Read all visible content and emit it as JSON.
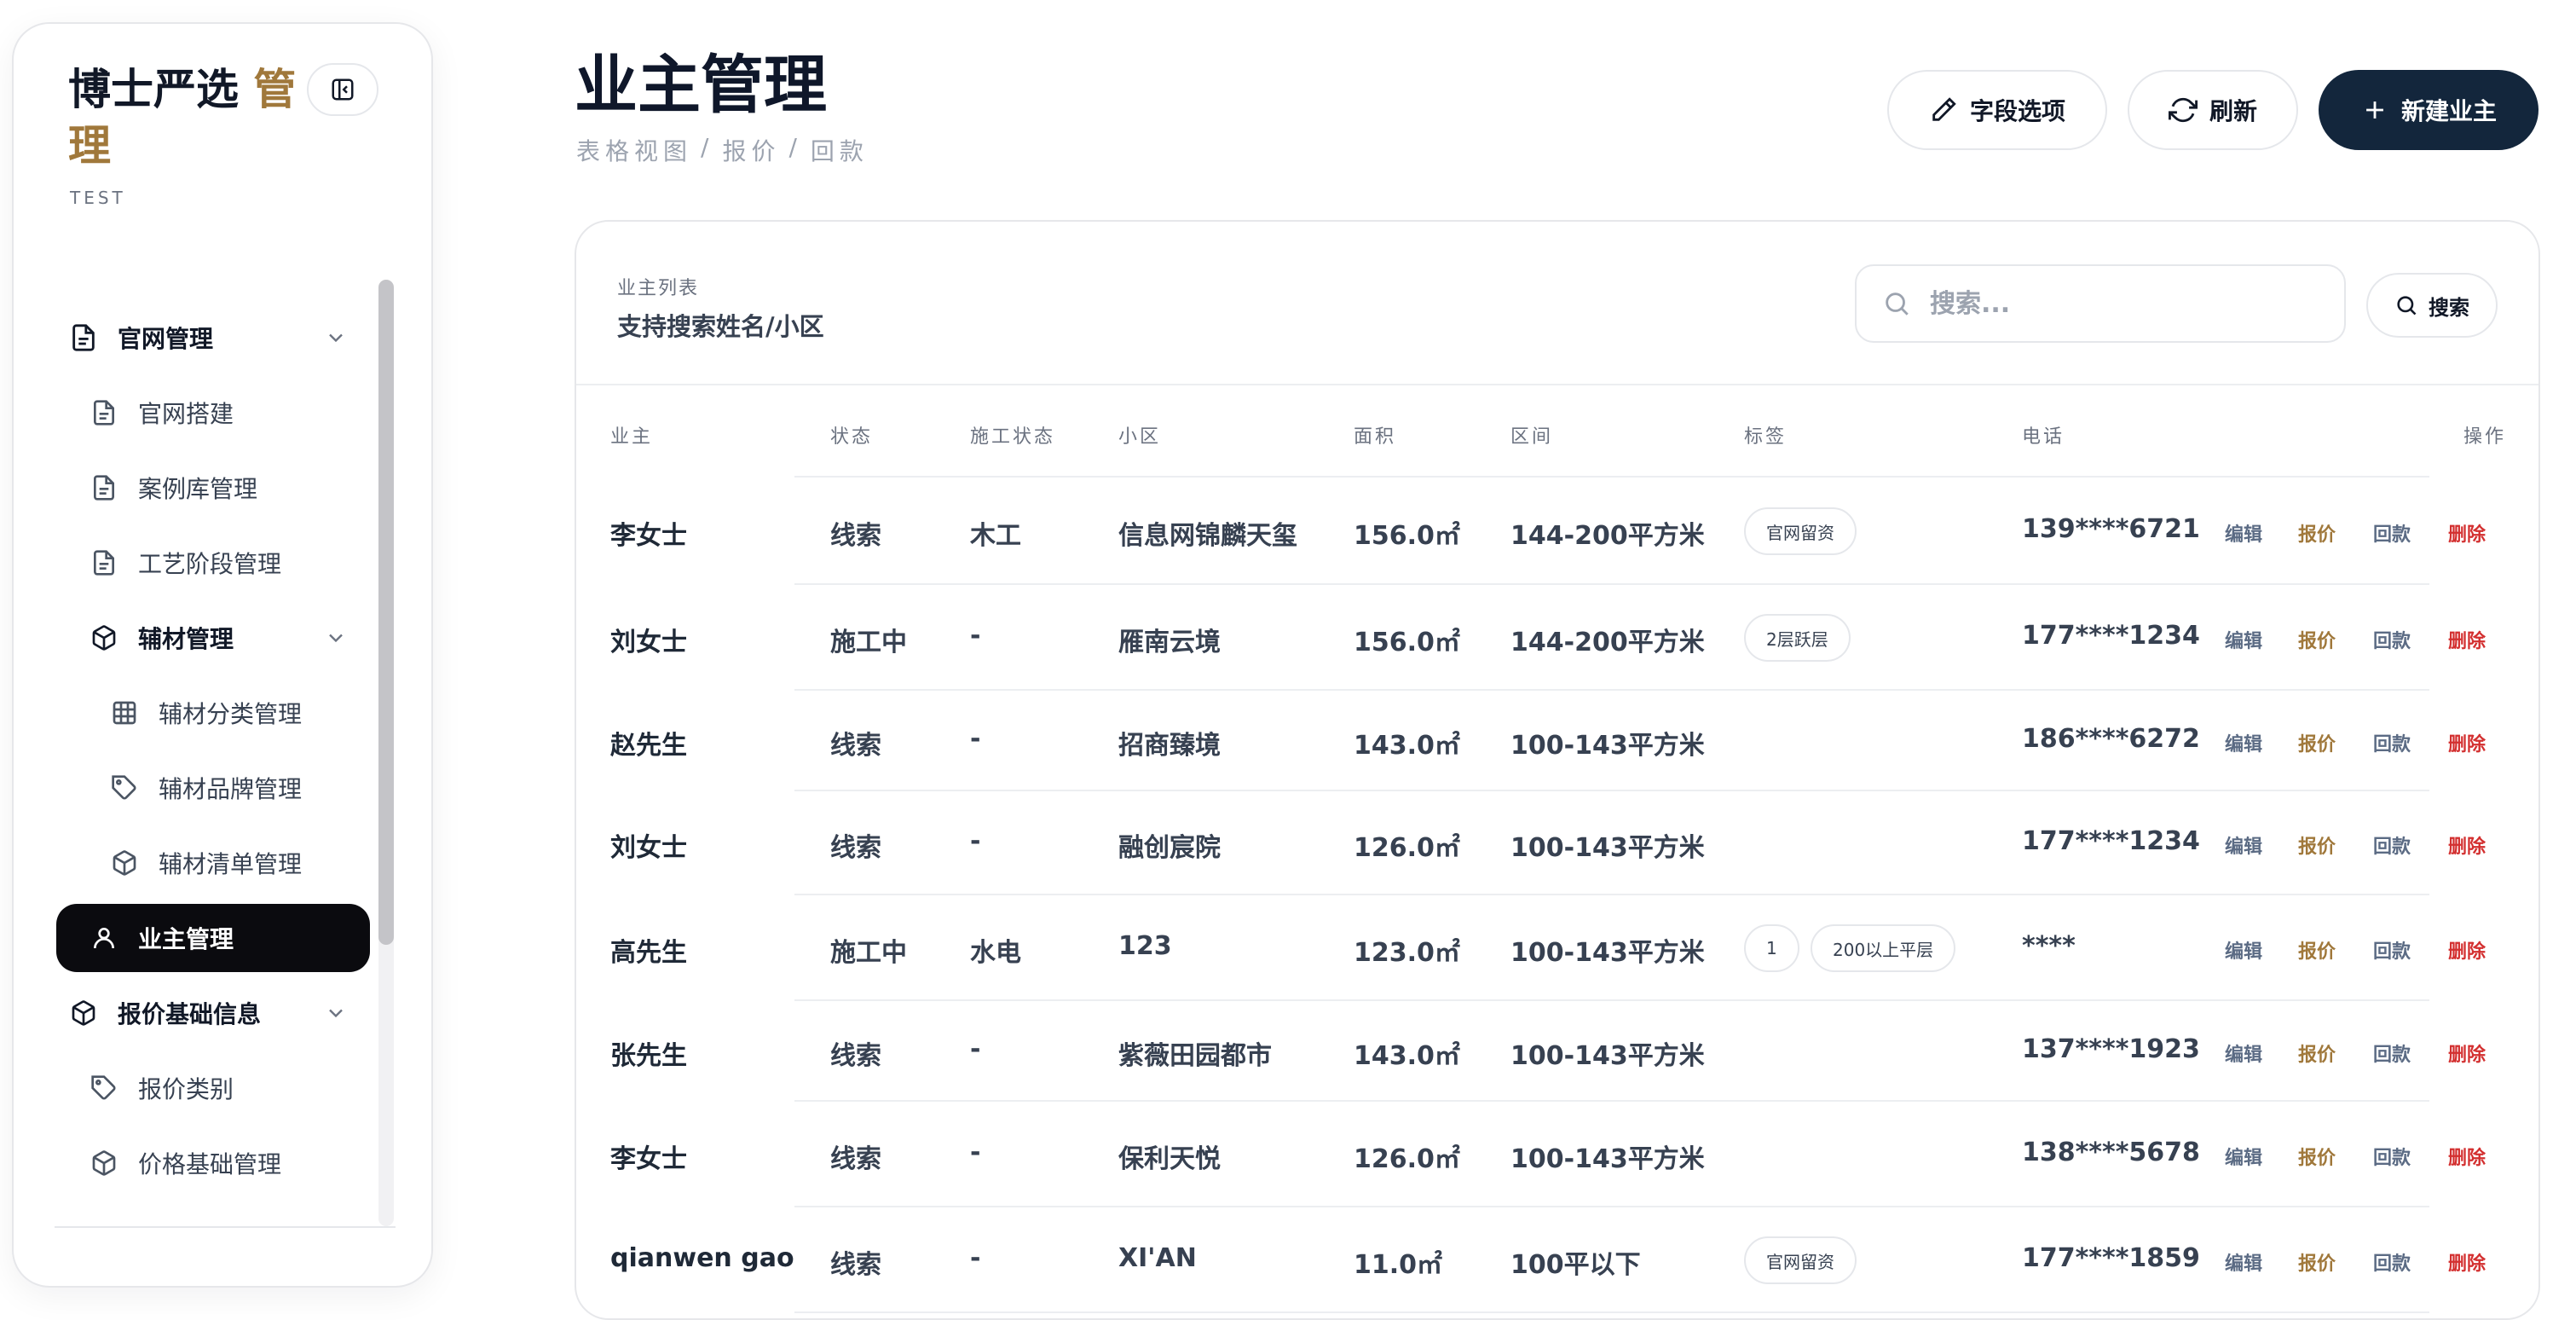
{
  "brand": {
    "name_part1": "博士严选",
    "name_part2": "管",
    "name_part3": "理",
    "subtitle": "TEST"
  },
  "sidebar": {
    "items": [
      {
        "label": "官网管理",
        "icon": "document-icon",
        "group": true,
        "expanded": true
      },
      {
        "label": "官网搭建",
        "icon": "document-icon"
      },
      {
        "label": "案例库管理",
        "icon": "document-icon"
      },
      {
        "label": "工艺阶段管理",
        "icon": "document-icon"
      },
      {
        "label": "辅材管理",
        "icon": "box-icon",
        "group": true,
        "expanded": true
      },
      {
        "label": "辅材分类管理",
        "icon": "grid-icon"
      },
      {
        "label": "辅材品牌管理",
        "icon": "tag-icon"
      },
      {
        "label": "辅材清单管理",
        "icon": "box-icon"
      },
      {
        "label": "业主管理",
        "icon": "user-icon",
        "active": true
      },
      {
        "label": "报价基础信息",
        "icon": "box-icon",
        "group": true,
        "expanded": true
      },
      {
        "label": "报价类别",
        "icon": "tag-icon"
      },
      {
        "label": "价格基础管理",
        "icon": "box-icon"
      }
    ]
  },
  "header": {
    "title": "业主管理",
    "breadcrumbs": [
      "表格视图",
      "/",
      "报价",
      "/",
      "回款"
    ],
    "buttons": {
      "fields": "字段选项",
      "refresh": "刷新",
      "create": "新建业主"
    }
  },
  "card": {
    "label": "业主列表",
    "subtitle": "支持搜索姓名/小区",
    "search_placeholder": "搜索...",
    "search_button": "搜索"
  },
  "table": {
    "headers": {
      "owner": "业主",
      "status": "状态",
      "construction": "施工状态",
      "community": "小区",
      "area": "面积",
      "range": "区间",
      "tags": "标签",
      "phone": "电话",
      "actions": "操作"
    },
    "action_labels": {
      "edit": "编辑",
      "quote": "报价",
      "payment": "回款",
      "delete": "删除"
    },
    "rows": [
      {
        "owner": "李女士",
        "status": "线索",
        "construction": "木工",
        "community": "信息网锦麟天玺",
        "area": "156.0㎡",
        "range": "144-200平方米",
        "tags": [
          "官网留资"
        ],
        "phone": "139****6721"
      },
      {
        "owner": "刘女士",
        "status": "施工中",
        "construction": "-",
        "community": "雁南云境",
        "area": "156.0㎡",
        "range": "144-200平方米",
        "tags": [
          "2层跃层"
        ],
        "phone": "177****1234"
      },
      {
        "owner": "赵先生",
        "status": "线索",
        "construction": "-",
        "community": "招商臻境",
        "area": "143.0㎡",
        "range": "100-143平方米",
        "tags": [],
        "phone": "186****6272"
      },
      {
        "owner": "刘女士",
        "status": "线索",
        "construction": "-",
        "community": "融创宸院",
        "area": "126.0㎡",
        "range": "100-143平方米",
        "tags": [],
        "phone": "177****1234"
      },
      {
        "owner": "高先生",
        "status": "施工中",
        "construction": "水电",
        "community": "123",
        "area": "123.0㎡",
        "range": "100-143平方米",
        "tags": [
          "1",
          "200以上平层"
        ],
        "phone": "****"
      },
      {
        "owner": "张先生",
        "status": "线索",
        "construction": "-",
        "community": "紫薇田园都市",
        "area": "143.0㎡",
        "range": "100-143平方米",
        "tags": [],
        "phone": "137****1923"
      },
      {
        "owner": "李女士",
        "status": "线索",
        "construction": "-",
        "community": "保利天悦",
        "area": "126.0㎡",
        "range": "100-143平方米",
        "tags": [],
        "phone": "138****5678"
      },
      {
        "owner": "qianwen gao",
        "status": "线索",
        "construction": "-",
        "community": "XI'AN",
        "area": "11.0㎡",
        "range": "100平以下",
        "tags": [
          "官网留资"
        ],
        "phone": "177****1859"
      }
    ]
  }
}
